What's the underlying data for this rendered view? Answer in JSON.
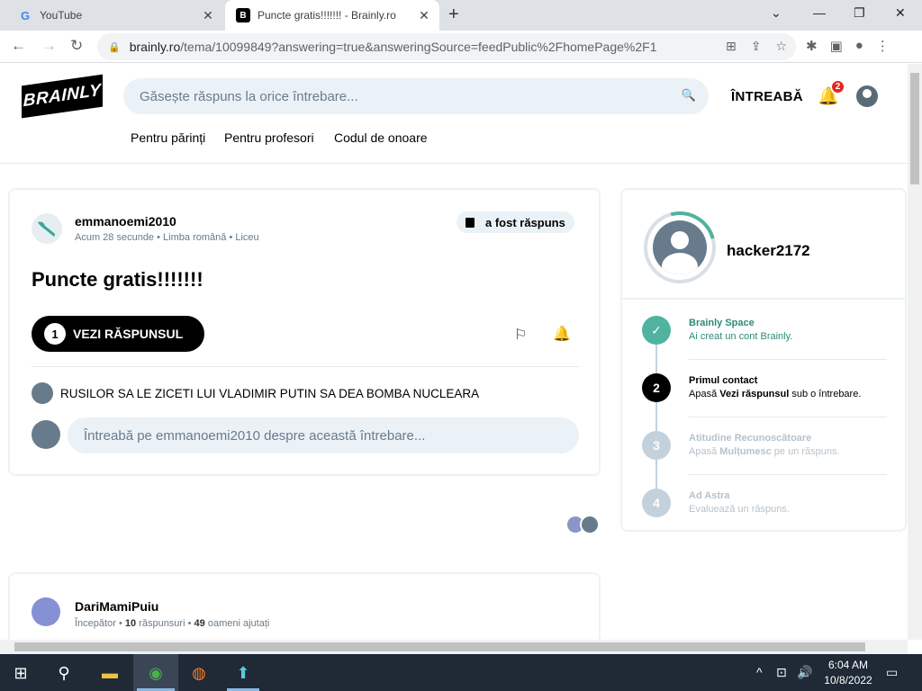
{
  "browser": {
    "tabs": [
      {
        "title": "YouTube",
        "favicon": "G"
      },
      {
        "title": "Puncte gratis!!!!!!! - Brainly.ro",
        "favicon": "B"
      }
    ],
    "url_host": "brainly.ro",
    "url_rest": "/tema/10099849?answering=true&answeringSource=feedPublic%2FhomePage%2F1",
    "icons": {
      "back": "←",
      "forward": "→",
      "reload": "↻",
      "lock": "🔒",
      "new_tab": "+",
      "close": "✕",
      "minimize": "—",
      "maximize": "❐",
      "dropdown": "⌄",
      "translate": "⊞",
      "share": "⇪",
      "star": "☆",
      "extensions": "✱",
      "sidebar": "▣",
      "profile": "●",
      "menu": "⋮"
    }
  },
  "header": {
    "logo": "BRAINLY",
    "search_placeholder": "Găsește răspuns la orice întrebare...",
    "search_icon": "🔍",
    "ask_label": "ÎNTREABĂ",
    "bell_icon": "🔔",
    "notification_count": "2",
    "subnav": [
      "Pentru părinți",
      "Pentru profesori",
      "Codul de onoare"
    ]
  },
  "question": {
    "author": "emmanoemi2010",
    "time": "Acum 28 secunde",
    "subject": "Limba română",
    "level": "Liceu",
    "separator": "•",
    "answered_label": "a fost răspuns",
    "title": "Puncte gratis!!!!!!!",
    "see_answer_count": "1",
    "see_answer_label": "VEZI RĂSPUNSUL",
    "flag_icon": "⚐",
    "follow_icon": "🔔",
    "comment": "RUSILOR SA LE ZICETI LUI VLADIMIR PUTIN SA DEA BOMBA NUCLEARA",
    "ask_placeholder": "Întreabă pe emmanoemi2010 despre această întrebare..."
  },
  "answer": {
    "author": "DariMamiPuiu",
    "rank": "Începător",
    "answers_count": "10",
    "answers_label": "răspunsuri",
    "helped_count": "49",
    "helped_label": "oameni ajutați",
    "separator": "•"
  },
  "sidebar": {
    "username": "hacker2172",
    "steps": [
      {
        "num": "✓",
        "title": "Brainly Space",
        "desc": "Ai creat un cont Brainly.",
        "state": "done"
      },
      {
        "num": "2",
        "title": "Primul contact",
        "desc_pre": "Apasă ",
        "desc_bold": "Vezi răspunsul",
        "desc_post": " sub o întrebare.",
        "state": "active"
      },
      {
        "num": "3",
        "title": "Atitudine Recunoscătoare",
        "desc_pre": "Apasă ",
        "desc_bold": "Mulțumesc",
        "desc_post": " pe un răspuns.",
        "state": "disabled"
      },
      {
        "num": "4",
        "title": "Ad Astra",
        "desc": "Evaluează un răspuns.",
        "state": "disabled"
      }
    ]
  },
  "taskbar": {
    "icons": {
      "start": "⊞",
      "search": "⚲",
      "explorer": "▬",
      "chrome": "◉",
      "firefox": "◍",
      "app": "⬆",
      "chevron": "^",
      "network": "⊡",
      "volume": "🔊",
      "notifications": "▭"
    },
    "time": "6:04 AM",
    "date": "10/8/2022"
  }
}
